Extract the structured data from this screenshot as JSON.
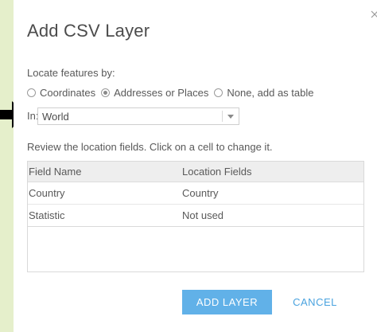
{
  "dialog": {
    "title": "Add CSV Layer",
    "locate_label": "Locate features by:",
    "radio_options": [
      {
        "label": "Coordinates",
        "checked": false
      },
      {
        "label": "Addresses or Places",
        "checked": true
      },
      {
        "label": "None, add as table",
        "checked": false
      }
    ],
    "in_label": "In:",
    "region_select": {
      "value": "World"
    },
    "review_text": "Review the location fields. Click on a cell to change it.",
    "table": {
      "headers": [
        "Field Name",
        "Location Fields"
      ],
      "rows": [
        [
          "Country",
          "Country"
        ],
        [
          "Statistic",
          "Not used"
        ]
      ]
    },
    "add_button": "ADD LAYER",
    "cancel_button": "CANCEL"
  },
  "colors": {
    "background": "#e5efcb",
    "accent": "#61b1e8",
    "link": "#4aa3df"
  }
}
